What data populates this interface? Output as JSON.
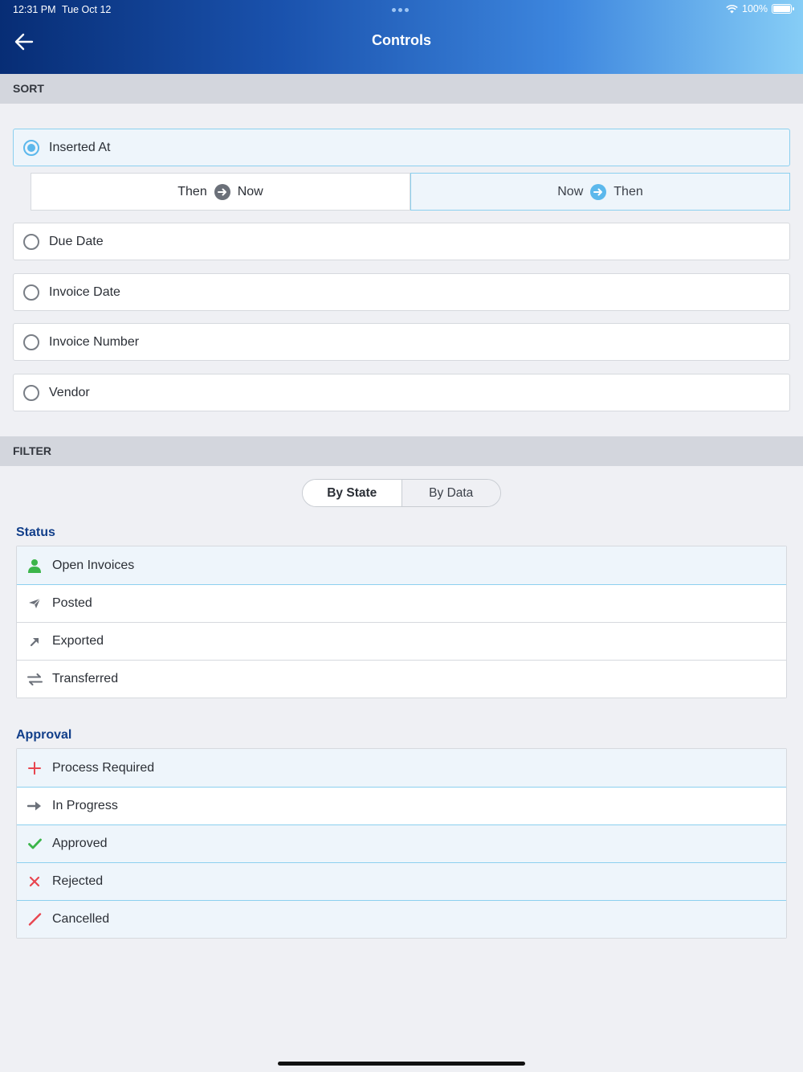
{
  "status_bar": {
    "time": "12:31 PM",
    "date": "Tue Oct 12",
    "battery": "100%"
  },
  "nav": {
    "title": "Controls",
    "back_icon": "arrow-left-icon"
  },
  "sort": {
    "header": "SORT",
    "selected_option": "Inserted At",
    "options": [
      {
        "label": "Inserted At",
        "selected": true
      },
      {
        "label": "Due Date",
        "selected": false
      },
      {
        "label": "Invoice Date",
        "selected": false
      },
      {
        "label": "Invoice Number",
        "selected": false
      },
      {
        "label": "Vendor",
        "selected": false
      }
    ],
    "order": {
      "ascending": {
        "from": "Then",
        "to": "Now",
        "active": false
      },
      "descending": {
        "from": "Now",
        "to": "Then",
        "active": true
      }
    }
  },
  "filter": {
    "header": "FILTER",
    "tabs": [
      {
        "label": "By State",
        "active": true
      },
      {
        "label": "By Data",
        "active": false
      }
    ],
    "status": {
      "title": "Status",
      "items": [
        {
          "label": "Open Invoices",
          "icon": "person-icon",
          "color": "#3bb54a",
          "selected": true
        },
        {
          "label": "Posted",
          "icon": "paper-plane-icon",
          "color": "#6b7079",
          "selected": false
        },
        {
          "label": "Exported",
          "icon": "arrow-up-right-icon",
          "color": "#6b7079",
          "selected": false
        },
        {
          "label": "Transferred",
          "icon": "swap-arrows-icon",
          "color": "#6b7079",
          "selected": false
        }
      ]
    },
    "approval": {
      "title": "Approval",
      "items": [
        {
          "label": "Process Required",
          "icon": "plus-icon",
          "color": "#e8454f",
          "selected": true
        },
        {
          "label": "In Progress",
          "icon": "arrow-right-icon",
          "color": "#6b7079",
          "selected": false
        },
        {
          "label": "Approved",
          "icon": "checkmark-icon",
          "color": "#3bb54a",
          "selected": true
        },
        {
          "label": "Rejected",
          "icon": "x-icon",
          "color": "#e8454f",
          "selected": true
        },
        {
          "label": "Cancelled",
          "icon": "slash-icon",
          "color": "#e8454f",
          "selected": true
        }
      ]
    }
  },
  "colors": {
    "accent": "#5cb8ec",
    "selected_bg": "#eef5fb",
    "group_title": "#123f8a"
  }
}
